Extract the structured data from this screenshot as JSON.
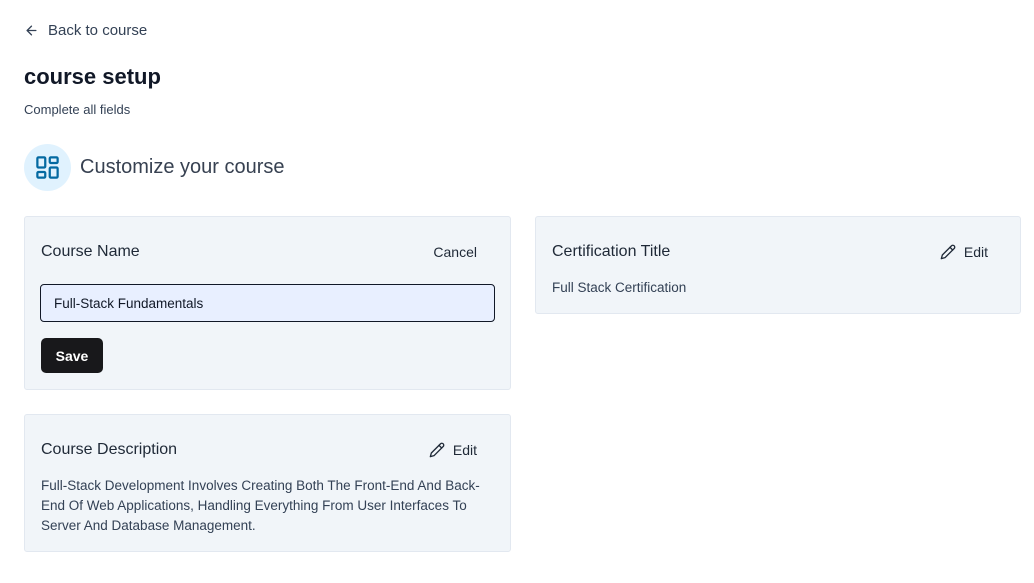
{
  "back_link": {
    "label": "Back to course",
    "icon": "arrow-left-icon"
  },
  "page": {
    "title": "course setup",
    "subtitle": "Complete all fields"
  },
  "section": {
    "title": "Customize your course",
    "icon": "layout-dashboard-icon"
  },
  "course_name": {
    "label": "Course Name",
    "cancel_label": "Cancel",
    "value": "Full-Stack Fundamentals",
    "save_label": "Save"
  },
  "certification": {
    "label": "Certification Title",
    "edit_label": "Edit",
    "value": "Full Stack Certification"
  },
  "description": {
    "label": "Course Description",
    "edit_label": "Edit",
    "value": "Full-Stack Development Involves Creating Both The Front-End And Back-End Of Web Applications, Handling Everything From User Interfaces To Server And Database Management."
  },
  "colors": {
    "accent_icon": "#0369a1",
    "icon_bg": "#e0f2fe",
    "card_bg": "#f1f5f9",
    "input_bg": "#e8efff",
    "button_bg": "#18181b"
  }
}
